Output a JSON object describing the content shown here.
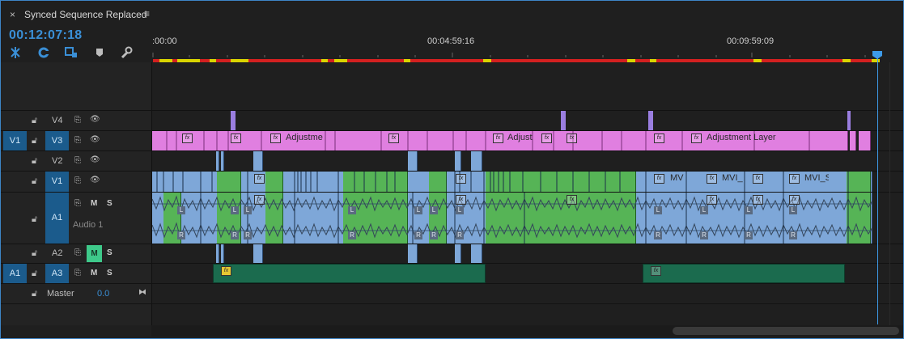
{
  "panel": {
    "close_glyph": "×",
    "title": "Synced Sequence Replaced",
    "menu_glyph": "≡"
  },
  "timecode": "00:12:07:18",
  "toolbar": {
    "icons": [
      "snap-icon",
      "linked-selection-icon",
      "add-marker-mode-icon",
      "marker-icon",
      "wrench-settings-icon"
    ]
  },
  "ruler": {
    "ticks": [
      ":00:00",
      "00:04:59:16",
      "00:09:59:09"
    ]
  },
  "tracks": {
    "v4": {
      "label": "V4"
    },
    "v3": {
      "label": "V3",
      "source": "V1"
    },
    "v2": {
      "label": "V2"
    },
    "v1": {
      "label": "V1"
    },
    "a1": {
      "label": "A1",
      "name": "Audio 1",
      "m": "M",
      "s": "S"
    },
    "a2": {
      "label": "A2",
      "m": "M",
      "s": "S"
    },
    "a3": {
      "label": "A3",
      "source": "A1",
      "m": "M",
      "s": "S"
    },
    "master": {
      "label": "Master",
      "value": "0.0"
    }
  },
  "clips": {
    "fx": "fx",
    "v3_name_1": "Adjustme",
    "v3_name_2": "Adjust",
    "v3_name_3": "Adjustment Layer",
    "v1_name_1": "MV",
    "v1_name_2": "MVI_",
    "v1_name_3": "MVI_S",
    "channel_l": "L",
    "channel_r": "R"
  },
  "colors": {
    "accent": "#3a8fd6",
    "adjustment": "#e07fe0",
    "video": "#7ea7d8",
    "audio_green": "#56b456",
    "a3_clip": "#1b6b4e",
    "work_area": "#d9d400",
    "render_red": "#d32020"
  }
}
